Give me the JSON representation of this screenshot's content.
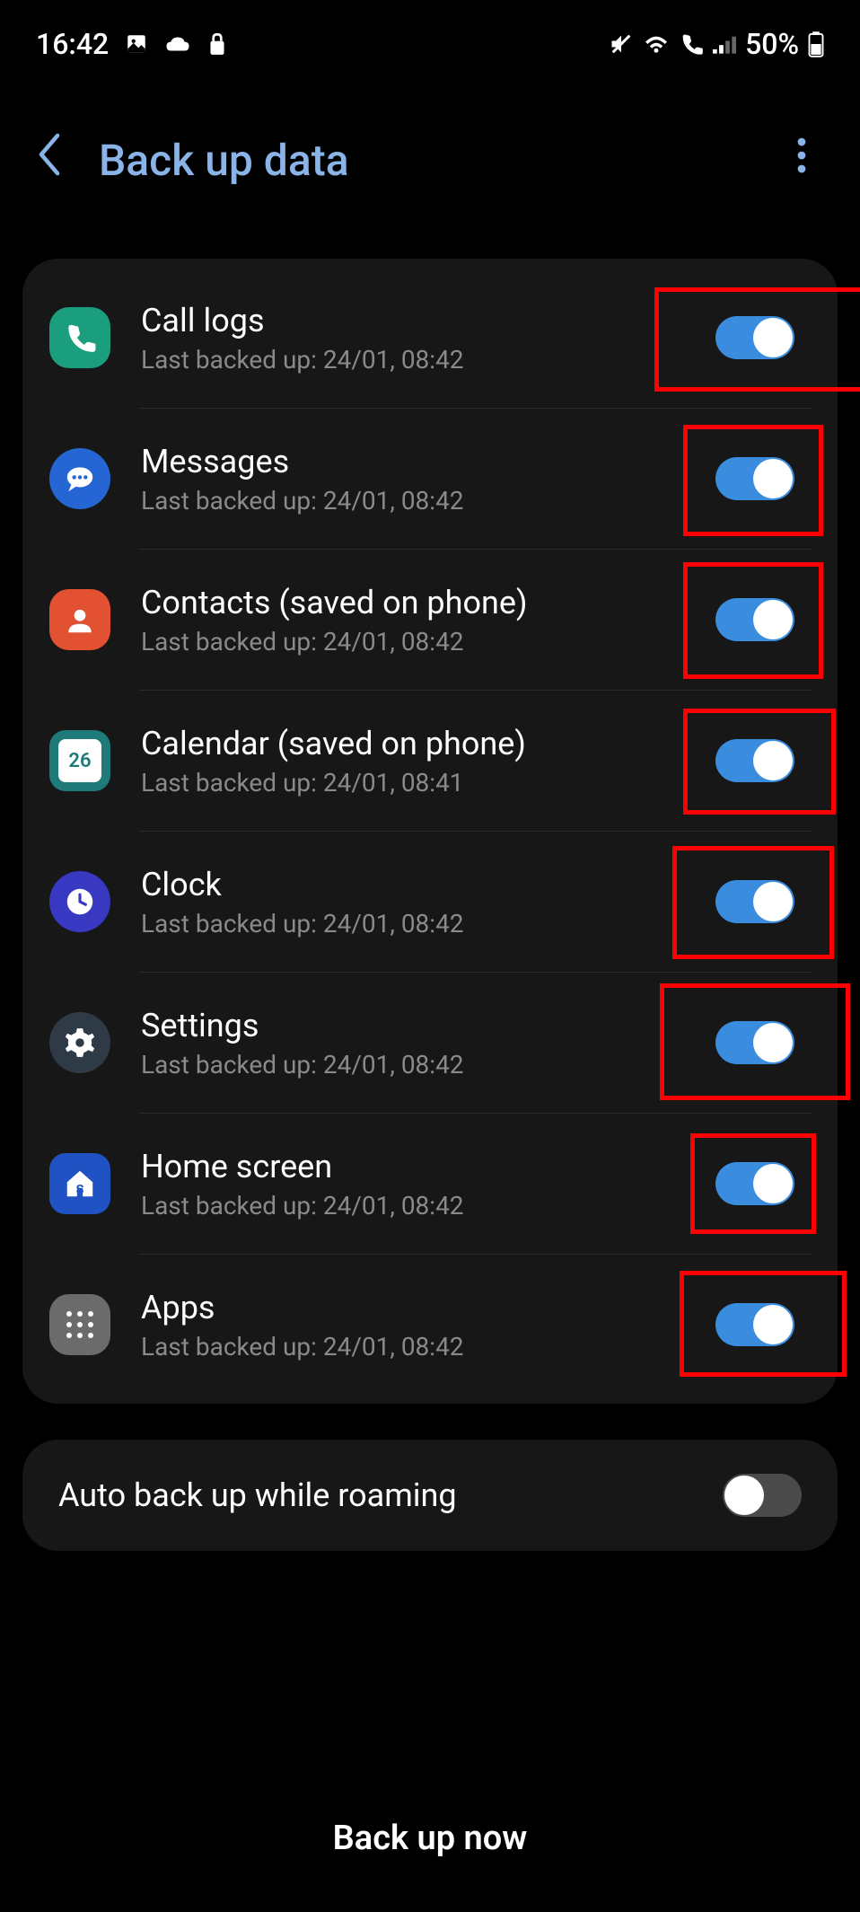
{
  "status": {
    "time": "16:42",
    "battery_text": "50%"
  },
  "header": {
    "title": "Back up data"
  },
  "items": [
    {
      "title": "Call logs",
      "sub": "Last backed up: 24/01, 08:42"
    },
    {
      "title": "Messages",
      "sub": "Last backed up: 24/01, 08:42"
    },
    {
      "title": "Contacts (saved on phone)",
      "sub": "Last backed up: 24/01, 08:42"
    },
    {
      "title": "Calendar (saved on phone)",
      "sub": "Last backed up: 24/01, 08:41"
    },
    {
      "title": "Clock",
      "sub": "Last backed up: 24/01, 08:42"
    },
    {
      "title": "Settings",
      "sub": "Last backed up: 24/01, 08:42"
    },
    {
      "title": "Home screen",
      "sub": "Last backed up: 24/01, 08:42"
    },
    {
      "title": "Apps",
      "sub": "Last backed up: 24/01, 08:42"
    }
  ],
  "calendar_day": "26",
  "roaming": {
    "title": "Auto back up while roaming"
  },
  "bottom_button": "Back up now"
}
